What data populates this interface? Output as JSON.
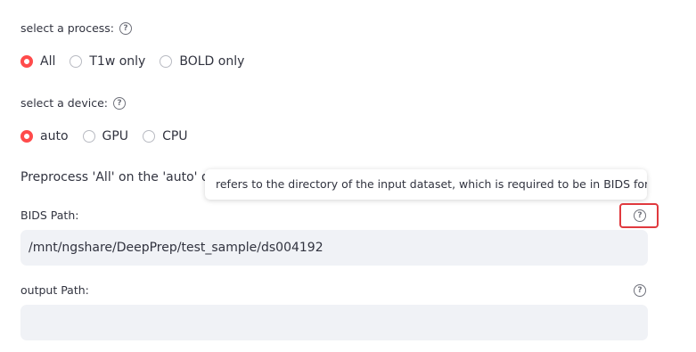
{
  "process": {
    "label": "select a process:",
    "help_glyph": "?",
    "options": [
      "All",
      "T1w only",
      "BOLD only"
    ],
    "selected": "All"
  },
  "device": {
    "label": "select a device:",
    "help_glyph": "?",
    "options": [
      "auto",
      "GPU",
      "CPU"
    ],
    "selected": "auto"
  },
  "summary_text": "Preprocess 'All' on the 'auto' de",
  "tooltip_text": "refers to the directory of the input dataset, which is required to be in BIDS format.",
  "bids_path": {
    "label": "BIDS Path:",
    "help_glyph": "?",
    "value": "/mnt/ngshare/DeepPrep/test_sample/ds004192"
  },
  "output_path": {
    "label": "output Path:",
    "help_glyph": "?",
    "value": ""
  },
  "colors": {
    "accent": "#ff4b4b",
    "input_bg": "#f0f2f6",
    "highlight": "#e0393e"
  }
}
